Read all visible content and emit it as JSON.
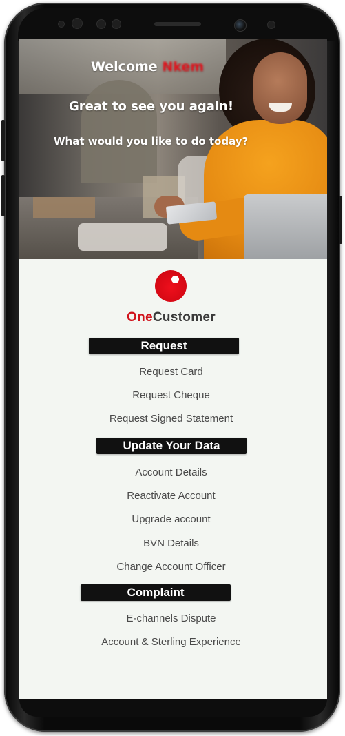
{
  "hero": {
    "welcome": "Welcome",
    "user_name": "Nkem",
    "greeting": "Great to see you again!",
    "question": "What would you like to do today?"
  },
  "brand": {
    "one": "One",
    "customer": "Customer",
    "color_one": "#d0131c",
    "logo_color": "#e30613"
  },
  "sections": {
    "request": {
      "title": "Request",
      "items": [
        "Request Card",
        "Request Cheque",
        "Request Signed Statement"
      ]
    },
    "update": {
      "title": "Update Your Data",
      "items": [
        "Account Details",
        "Reactivate Account",
        "Upgrade account",
        "BVN Details",
        "Change Account Officer"
      ]
    },
    "complaint": {
      "title": "Complaint",
      "items": [
        "E-channels Dispute",
        "Account & Sterling Experience"
      ]
    }
  }
}
